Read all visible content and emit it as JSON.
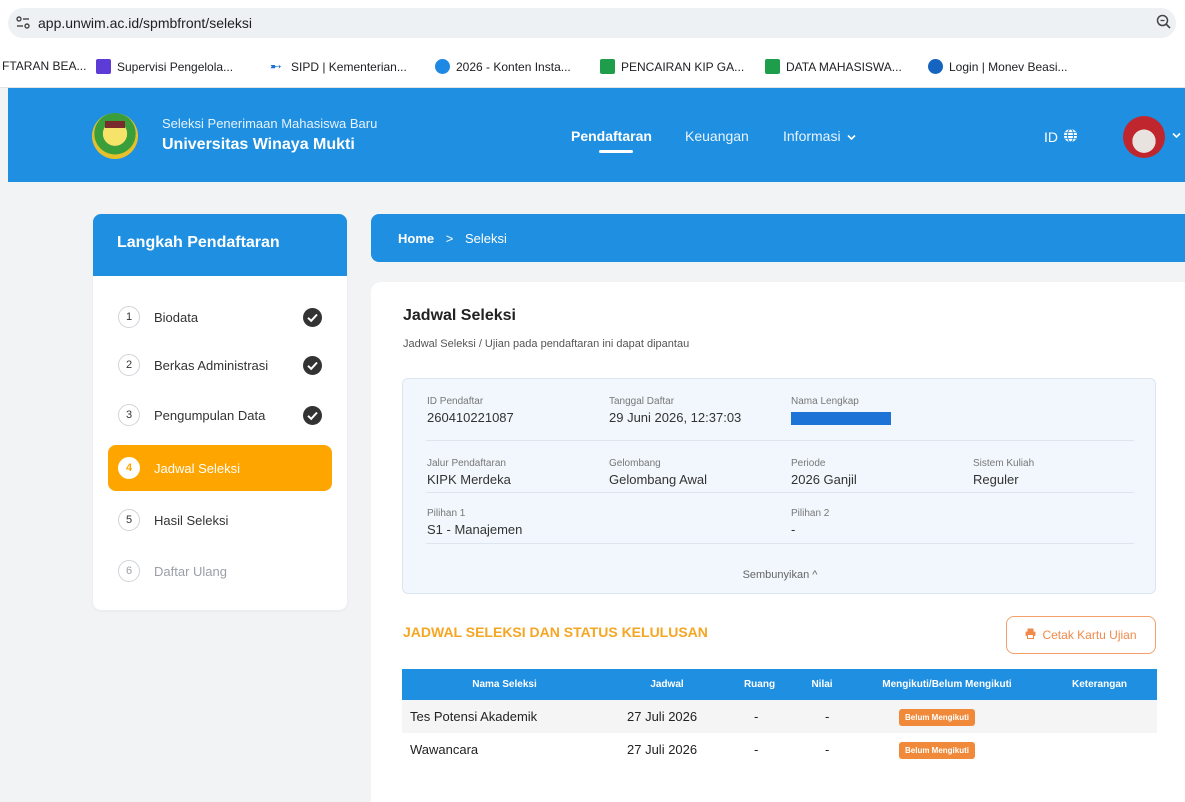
{
  "browser": {
    "url": "app.unwim.ac.id/spmbfront/seleksi",
    "bookmarks": [
      {
        "label": "FTARAN BEA...",
        "color": ""
      },
      {
        "label": "Supervisi Pengelola...",
        "color": "#5c3bd6"
      },
      {
        "label": "SIPD | Kementerian...",
        "color": "#1e6fd6"
      },
      {
        "label": "2026 - Konten Insta...",
        "color": "#1e88e5"
      },
      {
        "label": "PENCAIRAN KIP GA...",
        "color": "#1e9e4a"
      },
      {
        "label": "DATA MAHASISWA...",
        "color": "#1e9e4a"
      },
      {
        "label": "Login | Monev Beasi...",
        "color": "#1565c0"
      }
    ]
  },
  "header": {
    "subtitle": "Seleksi Penerimaan Mahasiswa Baru",
    "title": "Universitas Winaya Mukti",
    "nav": [
      "Pendaftaran",
      "Keuangan",
      "Informasi"
    ],
    "lang": "ID"
  },
  "steps": {
    "title": "Langkah Pendaftaran",
    "items": [
      {
        "num": "1",
        "label": "Biodata",
        "state": "done"
      },
      {
        "num": "2",
        "label": "Berkas Administrasi",
        "state": "done"
      },
      {
        "num": "3",
        "label": "Pengumpulan Data",
        "state": "done"
      },
      {
        "num": "4",
        "label": "Jadwal Seleksi",
        "state": "active"
      },
      {
        "num": "5",
        "label": "Hasil Seleksi",
        "state": "pending"
      },
      {
        "num": "6",
        "label": "Daftar Ulang",
        "state": "disabled"
      }
    ]
  },
  "breadcrumb": {
    "home": "Home",
    "sep": ">",
    "current": "Seleksi"
  },
  "main": {
    "title": "Jadwal Seleksi",
    "subtitle": "Jadwal Seleksi / Ujian pada pendaftaran ini dapat dipantau",
    "info": {
      "id_label": "ID Pendaftar",
      "id_value": "260410221087",
      "date_label": "Tanggal Daftar",
      "date_value": "29 Juni 2026, 12:37:03",
      "name_label": "Nama Lengkap",
      "jalur_label": "Jalur Pendaftaran",
      "jalur_value": "KIPK Merdeka",
      "gel_label": "Gelombang",
      "gel_value": "Gelombang Awal",
      "periode_label": "Periode",
      "periode_value": "2026 Ganjil",
      "sistem_label": "Sistem Kuliah",
      "sistem_value": "Reguler",
      "p1_label": "Pilihan 1",
      "p1_value": "S1 - Manajemen",
      "p2_label": "Pilihan 2",
      "p2_value": "-",
      "toggle": "Sembunyikan ^"
    },
    "schedule_title": "JADWAL SELEKSI DAN STATUS KELULUSAN",
    "print_button": "Cetak Kartu Ujian",
    "table": {
      "headers": [
        "Nama Seleksi",
        "Jadwal",
        "Ruang",
        "Nilai",
        "Mengikuti/Belum Mengikuti",
        "Keterangan"
      ],
      "rows": [
        {
          "name": "Tes Potensi Akademik",
          "date": "27 Juli 2026",
          "room": "-",
          "score": "-",
          "status": "Belum Mengikuti",
          "note": ""
        },
        {
          "name": "Wawancara",
          "date": "27 Juli 2026",
          "room": "-",
          "score": "-",
          "status": "Belum Mengikuti",
          "note": ""
        }
      ]
    }
  },
  "colors": {
    "primary": "#1e8fe1",
    "accent": "#ffa500",
    "badge": "#f08a3a"
  }
}
